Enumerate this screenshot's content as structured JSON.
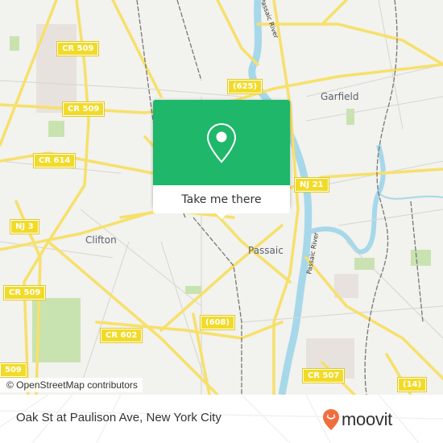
{
  "map": {
    "cities": [
      {
        "name": "Garfield"
      },
      {
        "name": "Clifton"
      },
      {
        "name": "Passaic"
      }
    ],
    "river_labels": [
      "Passaic River",
      "Passaic River"
    ],
    "shields": [
      "CR 509",
      "CR 509",
      "(625)",
      "CR 614",
      "NJ 21",
      "NJ 3",
      "CR 509",
      "CR 602",
      "(608)",
      "509",
      "CR 507",
      "(14)"
    ],
    "attribution": "© OpenStreetMap contributors",
    "colors": {
      "land": "#f2f2ee",
      "road": "#f7e06b",
      "water": "#a6d8ea",
      "park": "#c8e3b0",
      "rail": "#777777"
    }
  },
  "popup": {
    "icon": "location-pin-icon",
    "button_label": "Take me there",
    "color": "#1fb76a"
  },
  "footer": {
    "title": "Oak St at Paulison Ave, New York City",
    "brand": "moovit",
    "brand_icon": "moovit-logo-icon",
    "brand_color": "#f26d3d"
  }
}
